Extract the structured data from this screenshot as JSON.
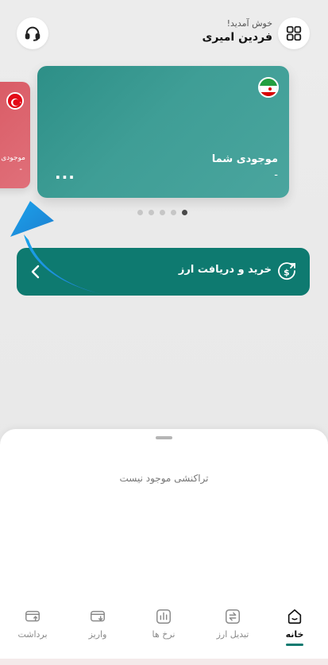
{
  "header": {
    "greeting": "خوش آمدید!",
    "user_name": "فردین امیری",
    "support_icon": "headset-icon",
    "menu_icon": "grid-icon"
  },
  "cards": {
    "main": {
      "balance_label": "موجودی شما",
      "balance_value": "-",
      "more": "...",
      "flag": "iran-flag",
      "color": "#3f9e96"
    },
    "side": {
      "balance_label": "موجودی",
      "balance_value": "-",
      "flag": "turkey-flag",
      "color": "#dd6670"
    }
  },
  "carousel": {
    "count": 5,
    "active_index": 4
  },
  "buy_sell": {
    "label": "خرید و دریافت ارز",
    "icon": "dollar-exchange-icon",
    "color": "#0e7a70"
  },
  "transactions": {
    "empty_message": "تراکنشی موجود نیست"
  },
  "nav": {
    "items": [
      {
        "label": "خانه",
        "icon": "home-icon",
        "active": true
      },
      {
        "label": "تبدیل ارز",
        "icon": "exchange-icon",
        "active": false
      },
      {
        "label": "نرخ ها",
        "icon": "rates-icon",
        "active": false
      },
      {
        "label": "واریز",
        "icon": "deposit-icon",
        "active": false
      },
      {
        "label": "برداشت",
        "icon": "withdraw-icon",
        "active": false
      }
    ]
  },
  "colors": {
    "accent": "#0e7a70",
    "arrow": "#1e9de0"
  }
}
